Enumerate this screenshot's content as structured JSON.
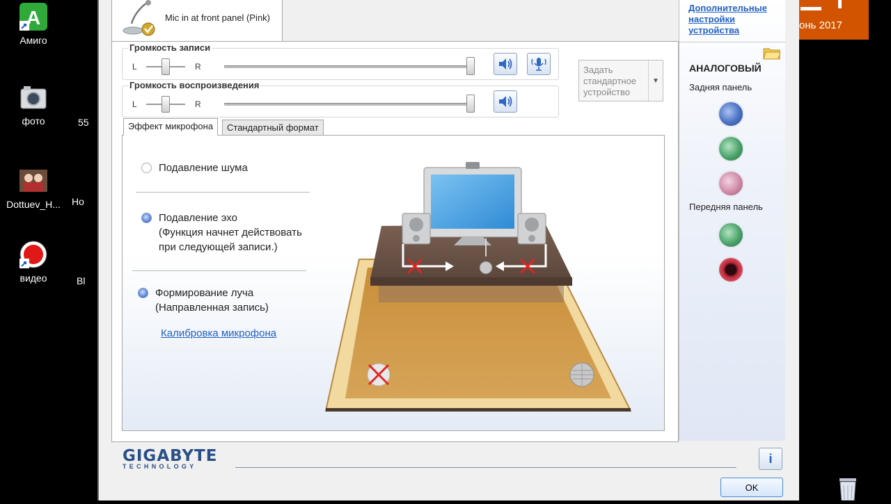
{
  "desktop": {
    "icons": [
      {
        "label": "Амиго"
      },
      {
        "label": "фото"
      },
      {
        "label": "Dottuev_H..."
      },
      {
        "label": "видео"
      }
    ],
    "partial_labels": [
      "55",
      "Ho",
      "Bl"
    ],
    "tile_text": "онь 2017"
  },
  "window": {
    "device_tab": {
      "label": "Mic in at front panel (Pink)"
    },
    "record_volume": {
      "title": "Громкость записи",
      "left": "L",
      "right": "R"
    },
    "playback_volume": {
      "title": "Громкость воспроизведения",
      "left": "L",
      "right": "R"
    },
    "set_default": {
      "label": "Задать стандартное устройство"
    },
    "subtabs": [
      {
        "label": "Эффект микрофона"
      },
      {
        "label": "Стандартный формат"
      }
    ],
    "options": {
      "noise": {
        "label": "Подавление шума"
      },
      "echo": {
        "label": "Подавление эхо",
        "note1": "(Функция начнет действовать",
        "note2": "при следующей записи.)"
      },
      "beam": {
        "label": "Формирование луча",
        "note1": "(Направленная запись)"
      }
    },
    "calibration_link": "Калибровка микрофона",
    "right_panel": {
      "advanced_link": "Дополнительные настройки устройства",
      "section_title": "АНАЛОГОВЫЙ",
      "rear_label": "Задняя панель",
      "front_label": "Передняя панель"
    },
    "brand": {
      "name": "GIGABYTE",
      "sub": "TECHNOLOGY"
    },
    "info_label": "i",
    "ok_label": "OK"
  },
  "colors": {
    "jack_blue": "#4a72c4",
    "jack_green": "#4aa36a",
    "jack_pink": "#d08aa8",
    "jack_red": "#c0283a",
    "brand": "#2a4f86",
    "link": "#2261c4",
    "tile": "#d35400"
  }
}
